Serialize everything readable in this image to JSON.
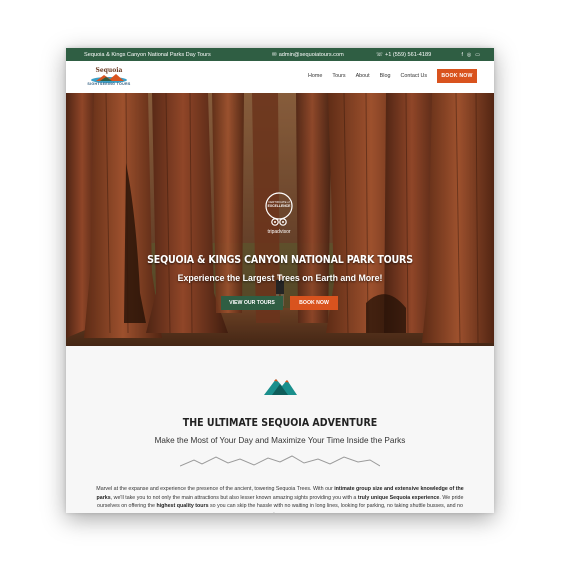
{
  "topbar": {
    "site_name": "Sequoia & Kings Canyon National Parks Day Tours",
    "email": "admin@sequoiatours.com",
    "phone": "+1 (559) 561-4189",
    "social": [
      "f",
      "◎",
      "▭"
    ]
  },
  "logo": {
    "title": "Sequoia",
    "subtitle": "SIGHTSEEING TOURS"
  },
  "nav": {
    "items": [
      "Home",
      "Tours",
      "About",
      "Blog",
      "Contact Us"
    ],
    "book_label": "BOOK NOW"
  },
  "hero": {
    "badge": {
      "line1": "CERTIFICATE of",
      "line2": "EXCELLENCE",
      "brand": "tripadvisor"
    },
    "title": "SEQUOIA & KINGS CANYON NATIONAL PARK TOURS",
    "subtitle": "Experience the Largest Trees on Earth and More!",
    "tours_button": "VIEW OUR TOURS",
    "book_button": "BOOK NOW"
  },
  "section": {
    "title": "THE ULTIMATE SEQUOIA ADVENTURE",
    "subtitle": "Make the Most of Your Day and Maximize Your Time Inside the Parks",
    "body_p1": "Marvel at the expanse and experience the presence of the ancient, towering Sequoia Trees. With our ",
    "body_b1": "intimate group size and extensive knowledge of the parks",
    "body_p2": ", we'll take you to not only the main attractions but also lesser known amazing sights providing you with a ",
    "body_b2": "truly unique Sequoia experience",
    "body_p3": ". We pride ourselves on offering the ",
    "body_b3": "highest quality tours",
    "body_p4": " so you can skip the hassle with no waiting in long lines, looking for parking, no taking shuttle busses, and no massive groups."
  },
  "colors": {
    "green": "#2f5e43",
    "orange": "#d9531e",
    "teal": "#1a8f8c"
  }
}
